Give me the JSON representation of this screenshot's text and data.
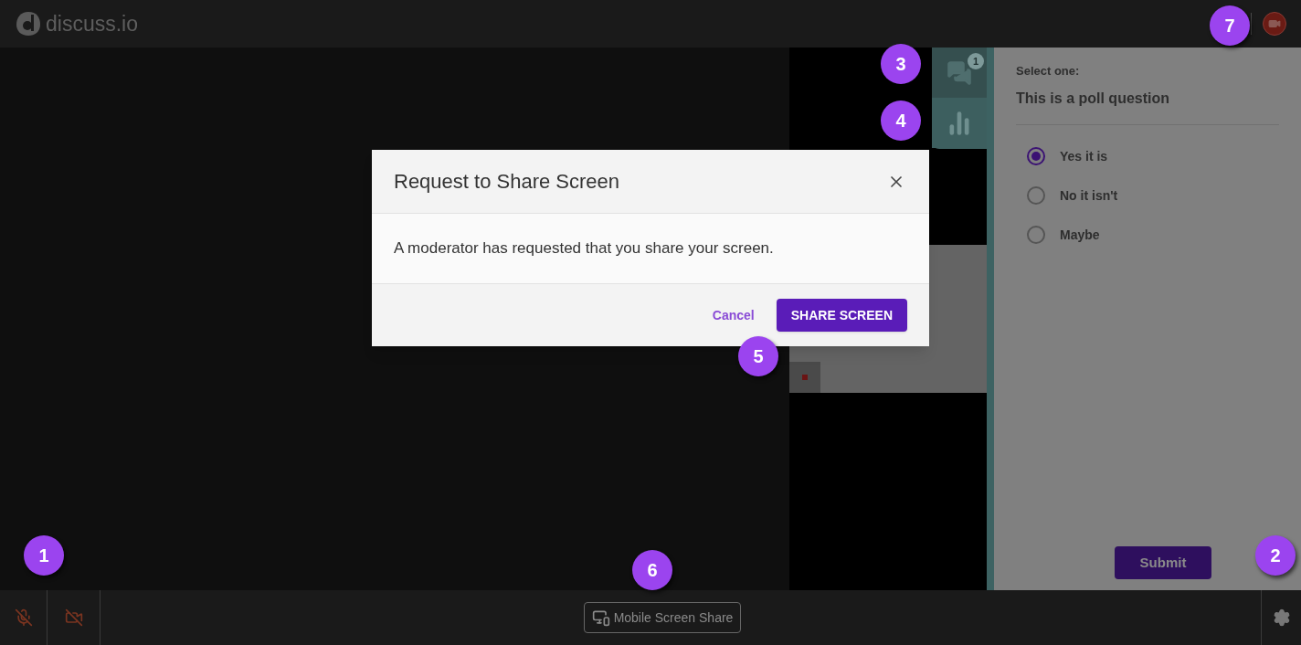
{
  "header": {
    "logo_text": "discuss.io",
    "record_button": {
      "on": true
    }
  },
  "side_tabs": [
    {
      "kind": "chat",
      "selected": false,
      "count": "1"
    },
    {
      "kind": "poll",
      "selected": true
    }
  ],
  "poll": {
    "prompt": "Select one:",
    "question": "This is a poll question",
    "options": [
      {
        "label": "Yes it is",
        "selected": true
      },
      {
        "label": "No it isn't",
        "selected": false
      },
      {
        "label": "Maybe",
        "selected": false
      }
    ],
    "submit": "Submit"
  },
  "dialog": {
    "title": "Request to Share Screen",
    "message": "A moderator has requested that you share your screen.",
    "cancel": "Cancel",
    "confirm": "SHARE SCREEN"
  },
  "bottom_bar": {
    "mic_muted": true,
    "camera_off": true,
    "screen_share": "Mobile Screen Share"
  },
  "callouts": [
    {
      "label": "1"
    },
    {
      "label": "2"
    },
    {
      "label": "3"
    },
    {
      "label": "4"
    },
    {
      "label": "5"
    },
    {
      "label": "6"
    },
    {
      "label": "7"
    }
  ]
}
